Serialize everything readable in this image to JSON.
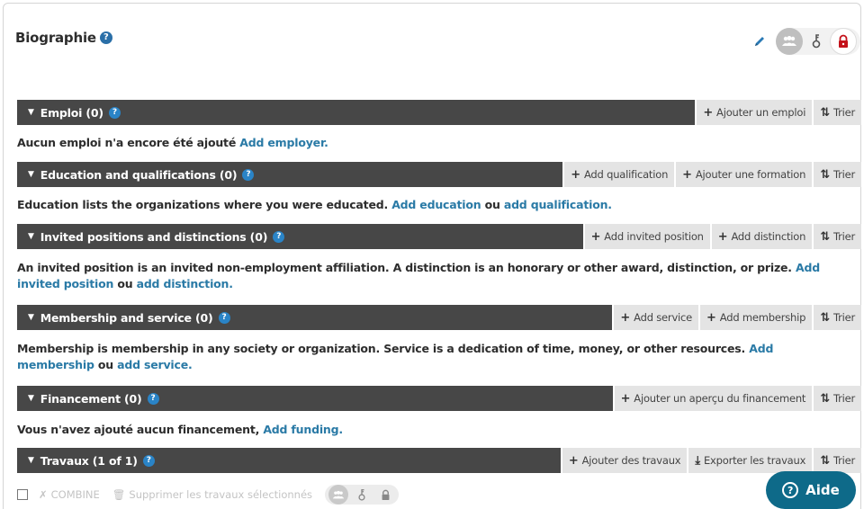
{
  "biography": {
    "title": "Biographie",
    "help": "?"
  },
  "visibility_icons": [
    "pencil-icon",
    "everyone-icon",
    "trusted-icon",
    "private-lock-icon"
  ],
  "colors": {
    "bar_bg": "#474747",
    "link": "#2a7aa6",
    "action_bg": "#e4e4e4",
    "help_button": "#0e6a89",
    "lock_red": "#c4121a"
  },
  "sections": [
    {
      "title": "Emploi (0)",
      "actions": [
        {
          "icon": "+",
          "label": "Ajouter un emploi"
        },
        {
          "icon": "⇅",
          "label": "Trier"
        }
      ],
      "desc_parts": [
        "Aucun emploi n'a encore été ajouté ",
        "Add employer."
      ]
    },
    {
      "title": "Education and qualifications (0)",
      "actions": [
        {
          "icon": "+",
          "label": "Add qualification"
        },
        {
          "icon": "+",
          "label": "Ajouter une formation"
        },
        {
          "icon": "⇅",
          "label": "Trier"
        }
      ],
      "desc_parts": [
        "Education lists the organizations where you were educated. ",
        "Add education",
        " ou ",
        "add qualification."
      ]
    },
    {
      "title": "Invited positions and distinctions (0)",
      "actions": [
        {
          "icon": "+",
          "label": "Add invited position"
        },
        {
          "icon": "+",
          "label": "Add distinction"
        },
        {
          "icon": "⇅",
          "label": "Trier"
        }
      ],
      "desc_parts": [
        "An invited position is an invited non-employment affiliation. A distinction is an honorary or other award, distinction, or prize. ",
        "Add invited position",
        " ou ",
        "add distinction."
      ]
    },
    {
      "title": "Membership and service (0)",
      "actions": [
        {
          "icon": "+",
          "label": "Add service"
        },
        {
          "icon": "+",
          "label": "Add membership"
        },
        {
          "icon": "⇅",
          "label": "Trier"
        }
      ],
      "desc_parts": [
        "Membership is membership in any society or organization. Service is a dedication of time, money, or other resources. ",
        "Add membership",
        " ou ",
        "add service."
      ]
    },
    {
      "title": "Financement (0)",
      "actions": [
        {
          "icon": "+",
          "label": "Ajouter un aperçu du financement"
        },
        {
          "icon": "⇅",
          "label": "Trier"
        }
      ],
      "desc_parts": [
        "Vous n'avez ajouté aucun financement, ",
        "Add funding."
      ]
    },
    {
      "title": "Travaux (1 of 1)",
      "actions": [
        {
          "icon": "+",
          "label": "Ajouter des travaux"
        },
        {
          "icon": "⤓",
          "label": "Exporter les travaux"
        },
        {
          "icon": "⇅",
          "label": "Trier"
        }
      ]
    }
  ],
  "works_toolbar": {
    "combine": "COMBINE",
    "delete_selected": "Supprimer les travaux sélectionnés"
  },
  "help_button": {
    "icon": "?",
    "label": "Aide"
  }
}
